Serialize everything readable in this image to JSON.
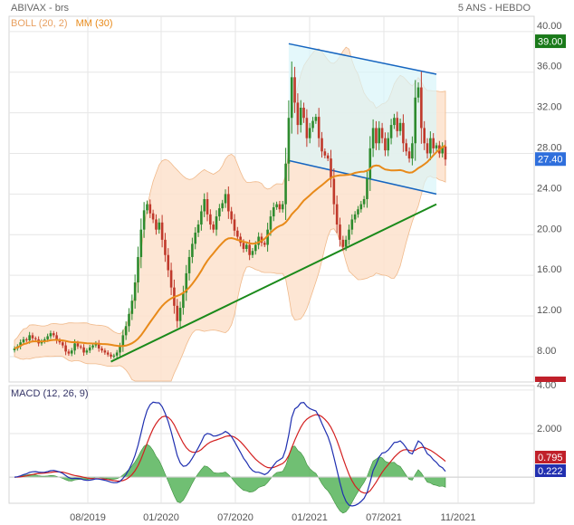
{
  "header": {
    "title": "ABIVAX - brs",
    "period": "5 ANS - HEBDO"
  },
  "legend": {
    "boll": "BOLL (20, 2)",
    "mm": "MM (30)"
  },
  "macd_label": "MACD (12, 26, 9)",
  "colors": {
    "up": "#2e8b2e",
    "down": "#c0392b",
    "mm": "#e88a1a",
    "boll_fill": "#fde2cc",
    "channel_fill": "#d9f5f9",
    "channel_line": "#1565c0",
    "trend_line": "#1a8a1a",
    "macd_line": "#1f2fb0",
    "signal_line": "#d32020",
    "hist": "#4caf50",
    "last_price_badge": "#2f6fdc",
    "resistance_badge": "#1a7a1a"
  },
  "chart_data": [
    {
      "type": "candlestick",
      "title": "ABIVAX - brs",
      "xlabel": "",
      "ylabel": "",
      "x_ticks": [
        "08/2019",
        "01/2020",
        "07/2020",
        "01/2021",
        "07/2021",
        "11/2021"
      ],
      "y_ticks": [
        "8.00",
        "12.00",
        "16.00",
        "20.00",
        "24.00",
        "28.00",
        "32.00",
        "36.00",
        "40.00"
      ],
      "ylim": [
        5.5,
        41.5
      ],
      "close_series": [
        8.8,
        9.0,
        9.4,
        9.7,
        9.6,
        10.1,
        9.8,
        9.7,
        9.3,
        9.5,
        9.7,
        10.0,
        10.3,
        10.1,
        9.6,
        9.4,
        9.1,
        8.5,
        8.3,
        8.6,
        9.3,
        9.0,
        8.9,
        8.4,
        8.6,
        8.9,
        9.1,
        9.3,
        8.8,
        8.6,
        8.4,
        8.2,
        8.0,
        8.1,
        8.4,
        9.0,
        10.1,
        11.0,
        12.2,
        13.5,
        15.3,
        17.8,
        20.5,
        22.4,
        23.0,
        22.1,
        21.5,
        20.5,
        21.2,
        19.5,
        18.0,
        16.5,
        14.8,
        13.0,
        11.5,
        12.8,
        14.3,
        16.2,
        17.8,
        19.1,
        20.2,
        21.0,
        22.3,
        23.5,
        22.0,
        21.0,
        20.5,
        21.8,
        22.6,
        23.1,
        24.0,
        22.3,
        21.5,
        20.4,
        19.8,
        19.2,
        18.6,
        19.0,
        18.0,
        18.4,
        19.0,
        19.8,
        19.2,
        19.0,
        20.5,
        21.8,
        22.7,
        23.0,
        22.5,
        23.0,
        27.0,
        31.5,
        35.5,
        33.0,
        30.8,
        32.5,
        31.5,
        29.5,
        30.5,
        31.2,
        31.6,
        29.5,
        28.2,
        27.8,
        27.5,
        25.5,
        23.0,
        21.0,
        19.5,
        18.8,
        19.5,
        20.5,
        21.5,
        22.0,
        22.5,
        23.0,
        23.5,
        25.5,
        28.5,
        30.5,
        29.0,
        30.5,
        29.5,
        28.3,
        29.5,
        30.8,
        31.5,
        30.2,
        31.0,
        29.0,
        28.2,
        27.5,
        29.0,
        33.5,
        34.5,
        30.5,
        29.0,
        28.0,
        29.5,
        28.5,
        28.8,
        28.0,
        28.7,
        27.4
      ],
      "bollinger": {
        "period": 20,
        "mult": 2
      },
      "moving_average": {
        "period": 30
      },
      "last_price": "27.40",
      "resistance_level": "39.00",
      "channel": {
        "upper": [
          [
            91,
            38.8
          ],
          [
            140,
            35.8
          ]
        ],
        "lower": [
          [
            91,
            27.3
          ],
          [
            140,
            24.0
          ]
        ]
      },
      "trendline": [
        [
          32,
          7.5
        ],
        [
          140,
          23.0
        ]
      ]
    },
    {
      "type": "macd",
      "title": "MACD (12, 26, 9)",
      "params": [
        12,
        26,
        9
      ],
      "y_ticks": [
        "0.000",
        "2.000",
        "4.00"
      ],
      "ylim": [
        -1.2,
        4.2
      ],
      "macd_value": "0.222",
      "signal_value": "0.795"
    }
  ]
}
